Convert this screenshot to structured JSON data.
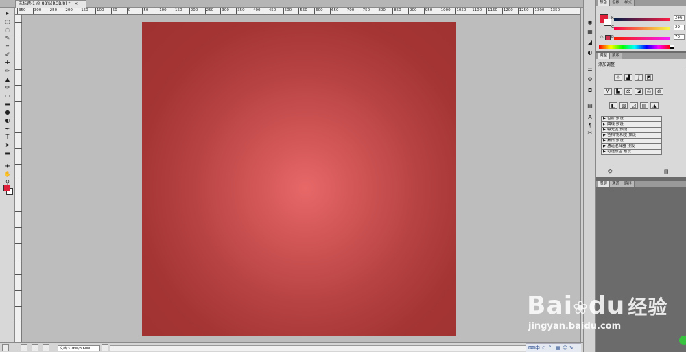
{
  "document": {
    "tab_title": "未标题-1 @ 88%(RGB/8) *",
    "close_glyph": "×"
  },
  "ruler": {
    "labels": [
      "350",
      "300",
      "250",
      "200",
      "150",
      "100",
      "50",
      "0",
      "50",
      "100",
      "150",
      "200",
      "250",
      "300",
      "350",
      "400",
      "450",
      "500",
      "550",
      "600",
      "650",
      "700",
      "750",
      "800",
      "850",
      "900",
      "950",
      "1000",
      "1050",
      "1100",
      "1150",
      "1200",
      "1250",
      "1300",
      "1350"
    ]
  },
  "tools": [
    "move-icon",
    "marquee-icon",
    "lasso-icon",
    "quick-select-icon",
    "crop-icon",
    "eyedropper-icon",
    "healing-icon",
    "brush-icon",
    "stamp-icon",
    "history-brush-icon",
    "eraser-icon",
    "gradient-icon",
    "blur-icon",
    "dodge-icon",
    "pen-icon",
    "type-icon",
    "path-select-icon",
    "shape-icon",
    "3d-icon",
    "hand-icon",
    "zoom-icon"
  ],
  "tool_glyphs": [
    "▸",
    "⬚",
    "◌",
    "✎",
    "⌗",
    "✐",
    "✚",
    "✏",
    "▲",
    "✑",
    "▭",
    "▬",
    "●",
    "◐",
    "✒",
    "T",
    "➤",
    "▬",
    "◈",
    "✋",
    "⚲"
  ],
  "colors": {
    "foreground": "#e0203a",
    "background": "#ffffff",
    "artboard": "#a53535",
    "highlight": "#e86868"
  },
  "status": {
    "zoom": "文档:3.76M/3.60M"
  },
  "panels": {
    "color_tabs": [
      "颜色",
      "色板",
      "样式"
    ],
    "color_values": {
      "r_label": "R",
      "g_label": "G",
      "b_label": "B",
      "r": "246",
      "g": "29",
      "b": "70"
    },
    "adjust_tabs": [
      "调整",
      "蒙版"
    ],
    "adjust_title": "添加调整",
    "presets": [
      "色阶 预设",
      "曲线 预设",
      "曝光度 预设",
      "色相/饱和度 预设",
      "黑白 预设",
      "通道混合器 预设",
      "可选颜色 预设"
    ],
    "layers_tabs": [
      "图层",
      "通道",
      "路径"
    ]
  },
  "watermark": {
    "brand": "Bai",
    "brand2": "du",
    "cn": "经验",
    "url": "jingyan.baidu.com"
  }
}
